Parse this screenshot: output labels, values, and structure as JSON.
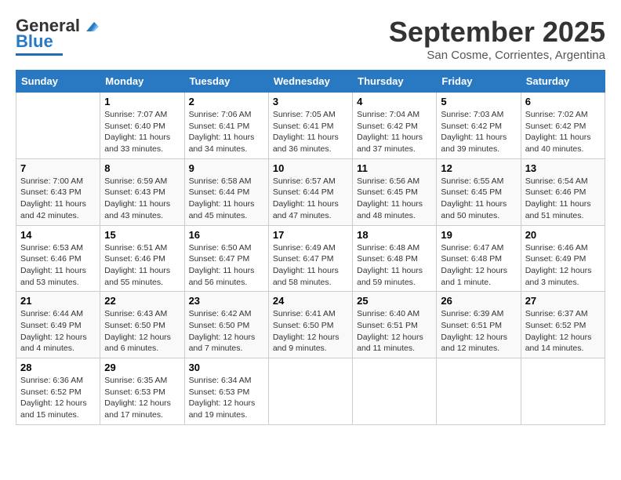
{
  "header": {
    "logo_general": "General",
    "logo_blue": "Blue",
    "month_title": "September 2025",
    "subtitle": "San Cosme, Corrientes, Argentina"
  },
  "days_of_week": [
    "Sunday",
    "Monday",
    "Tuesday",
    "Wednesday",
    "Thursday",
    "Friday",
    "Saturday"
  ],
  "weeks": [
    [
      {
        "day": "",
        "lines": []
      },
      {
        "day": "1",
        "lines": [
          "Sunrise: 7:07 AM",
          "Sunset: 6:40 PM",
          "Daylight: 11 hours",
          "and 33 minutes."
        ]
      },
      {
        "day": "2",
        "lines": [
          "Sunrise: 7:06 AM",
          "Sunset: 6:41 PM",
          "Daylight: 11 hours",
          "and 34 minutes."
        ]
      },
      {
        "day": "3",
        "lines": [
          "Sunrise: 7:05 AM",
          "Sunset: 6:41 PM",
          "Daylight: 11 hours",
          "and 36 minutes."
        ]
      },
      {
        "day": "4",
        "lines": [
          "Sunrise: 7:04 AM",
          "Sunset: 6:42 PM",
          "Daylight: 11 hours",
          "and 37 minutes."
        ]
      },
      {
        "day": "5",
        "lines": [
          "Sunrise: 7:03 AM",
          "Sunset: 6:42 PM",
          "Daylight: 11 hours",
          "and 39 minutes."
        ]
      },
      {
        "day": "6",
        "lines": [
          "Sunrise: 7:02 AM",
          "Sunset: 6:42 PM",
          "Daylight: 11 hours",
          "and 40 minutes."
        ]
      }
    ],
    [
      {
        "day": "7",
        "lines": [
          "Sunrise: 7:00 AM",
          "Sunset: 6:43 PM",
          "Daylight: 11 hours",
          "and 42 minutes."
        ]
      },
      {
        "day": "8",
        "lines": [
          "Sunrise: 6:59 AM",
          "Sunset: 6:43 PM",
          "Daylight: 11 hours",
          "and 43 minutes."
        ]
      },
      {
        "day": "9",
        "lines": [
          "Sunrise: 6:58 AM",
          "Sunset: 6:44 PM",
          "Daylight: 11 hours",
          "and 45 minutes."
        ]
      },
      {
        "day": "10",
        "lines": [
          "Sunrise: 6:57 AM",
          "Sunset: 6:44 PM",
          "Daylight: 11 hours",
          "and 47 minutes."
        ]
      },
      {
        "day": "11",
        "lines": [
          "Sunrise: 6:56 AM",
          "Sunset: 6:45 PM",
          "Daylight: 11 hours",
          "and 48 minutes."
        ]
      },
      {
        "day": "12",
        "lines": [
          "Sunrise: 6:55 AM",
          "Sunset: 6:45 PM",
          "Daylight: 11 hours",
          "and 50 minutes."
        ]
      },
      {
        "day": "13",
        "lines": [
          "Sunrise: 6:54 AM",
          "Sunset: 6:46 PM",
          "Daylight: 11 hours",
          "and 51 minutes."
        ]
      }
    ],
    [
      {
        "day": "14",
        "lines": [
          "Sunrise: 6:53 AM",
          "Sunset: 6:46 PM",
          "Daylight: 11 hours",
          "and 53 minutes."
        ]
      },
      {
        "day": "15",
        "lines": [
          "Sunrise: 6:51 AM",
          "Sunset: 6:46 PM",
          "Daylight: 11 hours",
          "and 55 minutes."
        ]
      },
      {
        "day": "16",
        "lines": [
          "Sunrise: 6:50 AM",
          "Sunset: 6:47 PM",
          "Daylight: 11 hours",
          "and 56 minutes."
        ]
      },
      {
        "day": "17",
        "lines": [
          "Sunrise: 6:49 AM",
          "Sunset: 6:47 PM",
          "Daylight: 11 hours",
          "and 58 minutes."
        ]
      },
      {
        "day": "18",
        "lines": [
          "Sunrise: 6:48 AM",
          "Sunset: 6:48 PM",
          "Daylight: 11 hours",
          "and 59 minutes."
        ]
      },
      {
        "day": "19",
        "lines": [
          "Sunrise: 6:47 AM",
          "Sunset: 6:48 PM",
          "Daylight: 12 hours",
          "and 1 minute."
        ]
      },
      {
        "day": "20",
        "lines": [
          "Sunrise: 6:46 AM",
          "Sunset: 6:49 PM",
          "Daylight: 12 hours",
          "and 3 minutes."
        ]
      }
    ],
    [
      {
        "day": "21",
        "lines": [
          "Sunrise: 6:44 AM",
          "Sunset: 6:49 PM",
          "Daylight: 12 hours",
          "and 4 minutes."
        ]
      },
      {
        "day": "22",
        "lines": [
          "Sunrise: 6:43 AM",
          "Sunset: 6:50 PM",
          "Daylight: 12 hours",
          "and 6 minutes."
        ]
      },
      {
        "day": "23",
        "lines": [
          "Sunrise: 6:42 AM",
          "Sunset: 6:50 PM",
          "Daylight: 12 hours",
          "and 7 minutes."
        ]
      },
      {
        "day": "24",
        "lines": [
          "Sunrise: 6:41 AM",
          "Sunset: 6:50 PM",
          "Daylight: 12 hours",
          "and 9 minutes."
        ]
      },
      {
        "day": "25",
        "lines": [
          "Sunrise: 6:40 AM",
          "Sunset: 6:51 PM",
          "Daylight: 12 hours",
          "and 11 minutes."
        ]
      },
      {
        "day": "26",
        "lines": [
          "Sunrise: 6:39 AM",
          "Sunset: 6:51 PM",
          "Daylight: 12 hours",
          "and 12 minutes."
        ]
      },
      {
        "day": "27",
        "lines": [
          "Sunrise: 6:37 AM",
          "Sunset: 6:52 PM",
          "Daylight: 12 hours",
          "and 14 minutes."
        ]
      }
    ],
    [
      {
        "day": "28",
        "lines": [
          "Sunrise: 6:36 AM",
          "Sunset: 6:52 PM",
          "Daylight: 12 hours",
          "and 15 minutes."
        ]
      },
      {
        "day": "29",
        "lines": [
          "Sunrise: 6:35 AM",
          "Sunset: 6:53 PM",
          "Daylight: 12 hours",
          "and 17 minutes."
        ]
      },
      {
        "day": "30",
        "lines": [
          "Sunrise: 6:34 AM",
          "Sunset: 6:53 PM",
          "Daylight: 12 hours",
          "and 19 minutes."
        ]
      },
      {
        "day": "",
        "lines": []
      },
      {
        "day": "",
        "lines": []
      },
      {
        "day": "",
        "lines": []
      },
      {
        "day": "",
        "lines": []
      }
    ]
  ]
}
